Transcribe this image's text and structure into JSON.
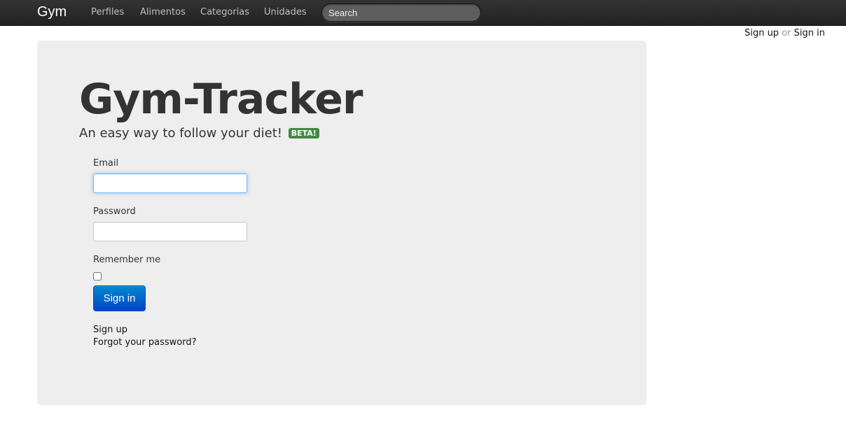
{
  "navbar": {
    "brand": "Gym",
    "links": [
      "Perfiles",
      "Alimentos",
      "Categorias",
      "Unidades"
    ],
    "search_placeholder": "Search"
  },
  "userbar": {
    "sign_up": "Sign up",
    "or": "or",
    "sign_in": "Sign in"
  },
  "hero": {
    "title": "Gym-Tracker",
    "tagline": "An easy way to follow your diet!",
    "badge": "BETA!"
  },
  "form": {
    "email_label": "Email",
    "email_value": "",
    "password_label": "Password",
    "password_value": "",
    "remember_label": "Remember me",
    "remember_checked": false,
    "submit_label": "Sign in",
    "signup_link": "Sign up",
    "forgot_link": "Forgot your password?"
  },
  "colors": {
    "navbar_bg": "#2b2b2b",
    "hero_bg": "#eeeeee",
    "primary_button": "#0055cc",
    "badge_success": "#468847"
  }
}
